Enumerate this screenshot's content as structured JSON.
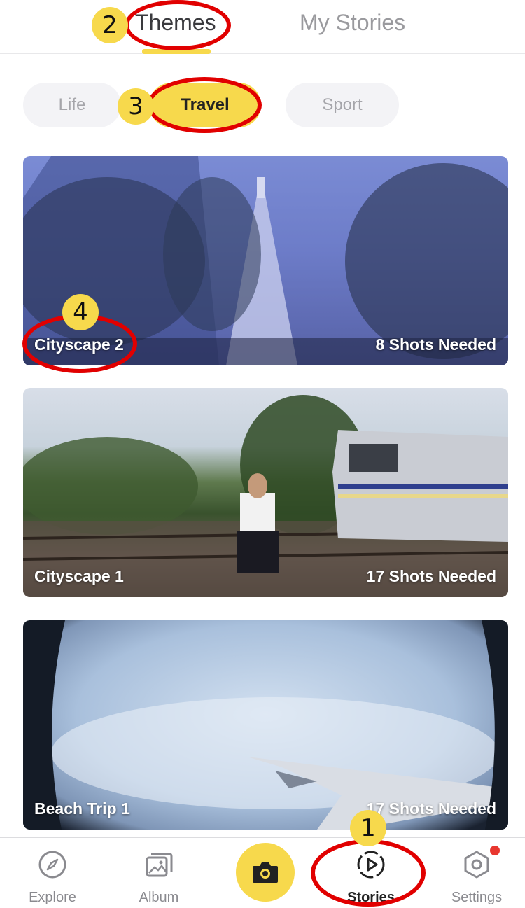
{
  "top_tabs": {
    "themes": "Themes",
    "my_stories": "My Stories"
  },
  "categories": [
    "Life",
    "Travel",
    "Sport"
  ],
  "selected_category": "Travel",
  "stories": [
    {
      "title": "Cityscape 2",
      "shots": "8 Shots Needed"
    },
    {
      "title": "Cityscape 1",
      "shots": "17 Shots Needed"
    },
    {
      "title": "Beach Trip 1",
      "shots": "17 Shots Needed"
    }
  ],
  "bottom_nav": {
    "explore": "Explore",
    "album": "Album",
    "stories": "Stories",
    "settings": "Settings",
    "active": "Stories"
  },
  "icons": {
    "explore": "compass-icon",
    "album": "photo-album-icon",
    "camera": "camera-icon",
    "stories": "story-play-icon",
    "settings": "hexagon-settings-icon"
  },
  "annotations": [
    "1",
    "2",
    "3",
    "4"
  ],
  "colors": {
    "accent": "#f7d94c",
    "annotation_ring": "#e10000",
    "notification_dot": "#e8372f"
  }
}
